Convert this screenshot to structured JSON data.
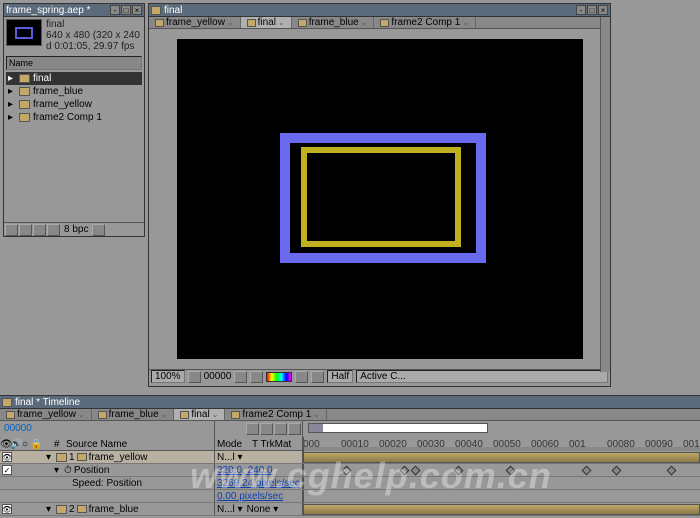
{
  "project": {
    "title": "frame_spring.aep *",
    "selected_name": "final",
    "selected_meta1": "640 x 480   (320 x 240",
    "selected_meta2": "d 0:01:05, 29.97 fps",
    "name_header": "Name",
    "items": [
      {
        "label": "final",
        "selected": true
      },
      {
        "label": "frame_blue",
        "selected": false
      },
      {
        "label": "frame_yellow",
        "selected": false
      },
      {
        "label": "frame2 Comp 1",
        "selected": false
      }
    ],
    "bpc": "8 bpc"
  },
  "comp": {
    "title": "final",
    "tabs": [
      {
        "label": "frame_yellow",
        "active": false
      },
      {
        "label": "final",
        "active": true
      },
      {
        "label": "frame_blue",
        "active": false
      },
      {
        "label": "frame2 Comp 1",
        "active": false
      }
    ],
    "zoom": "100%",
    "timecode": "00000",
    "res": "Half",
    "camera": "Active C..."
  },
  "timeline": {
    "title": "final * Timeline",
    "tabs": [
      {
        "label": "frame_yellow",
        "active": false
      },
      {
        "label": "frame_blue",
        "active": false
      },
      {
        "label": "final",
        "active": true
      },
      {
        "label": "frame2 Comp 1",
        "active": false
      }
    ],
    "current_time": "00000",
    "columns": {
      "num": "#",
      "source": "Source Name",
      "mode": "Mode",
      "trkmat": "T TrkMat"
    },
    "ticks": [
      "000",
      "00010",
      "00020",
      "00030",
      "00040",
      "00050",
      "00060",
      "001",
      "00080",
      "00090",
      "001"
    ],
    "rows": [
      {
        "type": "layer",
        "num": "1",
        "name": "frame_yellow",
        "mode": "N...l",
        "selected": true
      },
      {
        "type": "prop",
        "name": "Position",
        "value": "320.0, 240.0"
      },
      {
        "type": "prop",
        "name": "Speed: Position",
        "value": "3269.24 pixels/sec"
      },
      {
        "type": "prop",
        "name": "",
        "value": "0.00 pixels/sec"
      },
      {
        "type": "layer",
        "num": "2",
        "name": "frame_blue",
        "mode": "N...l",
        "trkmat": "None",
        "selected": false
      }
    ],
    "keyframe_positions": [
      40,
      98,
      109,
      152,
      204,
      280,
      310,
      365
    ]
  },
  "watermark": "www.cghelp.com.cn"
}
